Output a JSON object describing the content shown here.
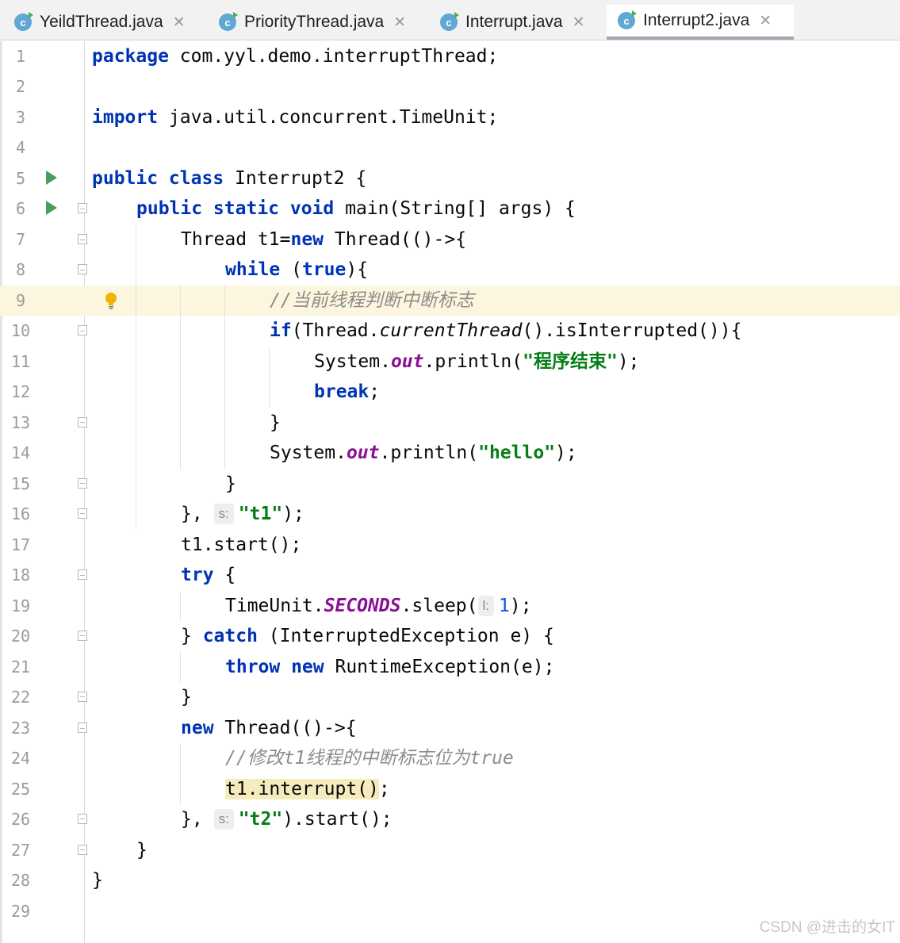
{
  "tabs": [
    {
      "label": "YeildThread.java",
      "active": false
    },
    {
      "label": "PriorityThread.java",
      "active": false
    },
    {
      "label": "Interrupt.java",
      "active": false
    },
    {
      "label": "Interrupt2.java",
      "active": true
    }
  ],
  "tab_close_glyph": "✕",
  "class_icon_letter": "c",
  "editor": {
    "highlighted_line": 9,
    "line_numbers": [
      "1",
      "2",
      "3",
      "4",
      "5",
      "6",
      "7",
      "8",
      "9",
      "10",
      "11",
      "12",
      "13",
      "14",
      "15",
      "16",
      "17",
      "18",
      "19",
      "20",
      "21",
      "22",
      "23",
      "24",
      "25",
      "26",
      "27",
      "28",
      "29"
    ],
    "code": {
      "l1_kw": "package",
      "l1_rest": " com.yyl.demo.interruptThread;",
      "l3_kw": "import",
      "l3_rest": " java.util.concurrent.TimeUnit;",
      "l5_kw": "public class",
      "l5_rest": " Interrupt2 {",
      "l6_kw": "public static void",
      "l6_rest": " main(String[] args) {",
      "l7_a": "Thread t1=",
      "l7_kw": "new",
      "l7_b": " Thread(()->{",
      "l8_kw": "while",
      "l8_a": " (",
      "l8_kw2": "true",
      "l8_b": "){",
      "l9_cmt": "//当前线程判断中断标志",
      "l10_kw": "if",
      "l10_a": "(Thread.",
      "l10_m": "currentThread",
      "l10_b": "().isInterrupted()){",
      "l11_a": "System.",
      "l11_f": "out",
      "l11_b": ".println(",
      "l11_s": "\"程序结束\"",
      "l11_c": ");",
      "l12_kw": "break",
      "l12_rest": ";",
      "l13": "}",
      "l14_a": "System.",
      "l14_f": "out",
      "l14_b": ".println(",
      "l14_s": "\"hello\"",
      "l14_c": ");",
      "l15": "}",
      "l16_a": "},",
      "l16_hint": "s:",
      "l16_s": "\"t1\"",
      "l16_b": ");",
      "l17": "t1.start();",
      "l18_kw": "try",
      "l18_rest": " {",
      "l19_a": "TimeUnit.",
      "l19_f": "SECONDS",
      "l19_b": ".sleep(",
      "l19_hint": "l:",
      "l19_n": "1",
      "l19_c": ");",
      "l20_a": "} ",
      "l20_kw": "catch",
      "l20_b": " (InterruptedException e) {",
      "l21_kw": "throw new",
      "l21_rest": " RuntimeException(e);",
      "l22": "}",
      "l23_kw": "new",
      "l23_rest": " Thread(()->{",
      "l24_cmt": "//修改t1线程的中断标志位为true",
      "l25_u": "t1.interrupt()",
      "l25_rest": ";",
      "l26_a": "},",
      "l26_hint": "s:",
      "l26_s": "\"t2\"",
      "l26_b": ").start();",
      "l27": "}",
      "l28": "}"
    }
  },
  "watermark": "CSDN @进击的女IT",
  "colors": {
    "keyword": "#0033b3",
    "string": "#067d17",
    "comment": "#8c8c8c",
    "field": "#871094",
    "number": "#1750eb",
    "run_icon": "#4a9e5c",
    "highlight_line": "#fbf6dd"
  }
}
